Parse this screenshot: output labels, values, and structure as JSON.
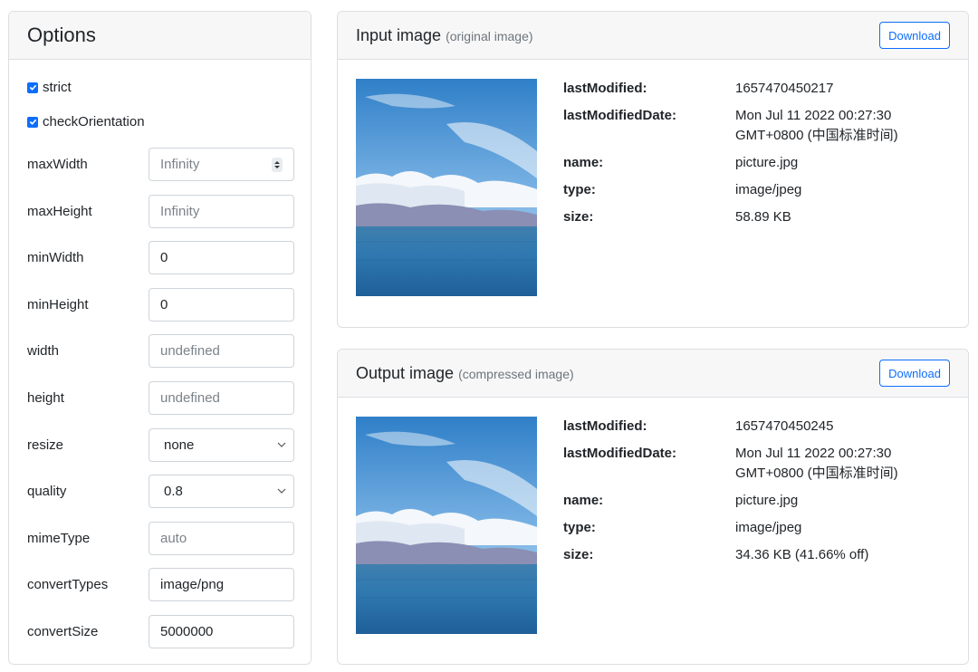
{
  "options": {
    "title": "Options",
    "checkboxes": [
      {
        "label": "strict",
        "checked": true
      },
      {
        "label": "checkOrientation",
        "checked": true
      }
    ],
    "fields": [
      {
        "label": "maxWidth",
        "value": "Infinity",
        "placeholder": true,
        "control": "number"
      },
      {
        "label": "maxHeight",
        "value": "Infinity",
        "placeholder": true,
        "control": "text"
      },
      {
        "label": "minWidth",
        "value": "0",
        "placeholder": false,
        "control": "text"
      },
      {
        "label": "minHeight",
        "value": "0",
        "placeholder": false,
        "control": "text"
      },
      {
        "label": "width",
        "value": "undefined",
        "placeholder": true,
        "control": "text"
      },
      {
        "label": "height",
        "value": "undefined",
        "placeholder": true,
        "control": "text"
      },
      {
        "label": "resize",
        "value": "none",
        "placeholder": false,
        "control": "select"
      },
      {
        "label": "quality",
        "value": "0.8",
        "placeholder": false,
        "control": "select"
      },
      {
        "label": "mimeType",
        "value": "auto",
        "placeholder": true,
        "control": "text"
      },
      {
        "label": "convertTypes",
        "value": "image/png",
        "placeholder": false,
        "control": "text"
      },
      {
        "label": "convertSize",
        "value": "5000000",
        "placeholder": false,
        "control": "text"
      }
    ]
  },
  "input": {
    "title": "Input image",
    "subtitle": "(original image)",
    "download_label": "Download",
    "meta": [
      {
        "key": "lastModified:",
        "value": "1657470450217"
      },
      {
        "key": "lastModifiedDate:",
        "value": "Mon Jul 11 2022 00:27:30 GMT+0800 (中国标准时间)"
      },
      {
        "key": "name:",
        "value": "picture.jpg"
      },
      {
        "key": "type:",
        "value": "image/jpeg"
      },
      {
        "key": "size:",
        "value": "58.89 KB"
      }
    ]
  },
  "output": {
    "title": "Output image",
    "subtitle": "(compressed image)",
    "download_label": "Download",
    "meta": [
      {
        "key": "lastModified:",
        "value": "1657470450245"
      },
      {
        "key": "lastModifiedDate:",
        "value": "Mon Jul 11 2022 00:27:30 GMT+0800 (中国标准时间)"
      },
      {
        "key": "name:",
        "value": "picture.jpg"
      },
      {
        "key": "type:",
        "value": "image/jpeg"
      },
      {
        "key": "size:",
        "value": "34.36 KB (41.66% off)"
      }
    ]
  },
  "colors": {
    "accent": "#0d6efd",
    "header_bg": "#f7f7f7",
    "border": "#dcdfe3"
  }
}
